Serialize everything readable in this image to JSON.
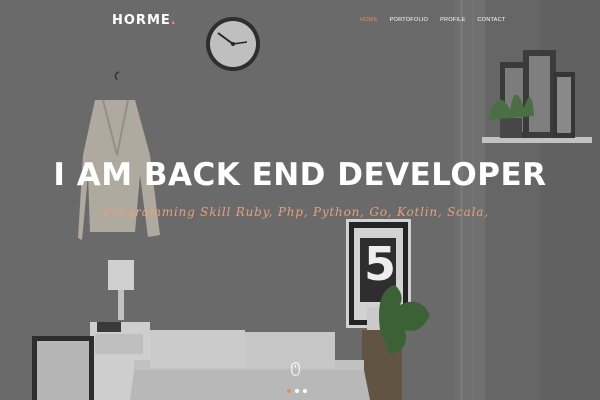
{
  "brand": {
    "name": "HORME",
    "dot": "."
  },
  "nav": {
    "items": [
      {
        "label": "HOME",
        "active": true
      },
      {
        "label": "PORTOFOLIO",
        "active": false
      },
      {
        "label": "PROFILE",
        "active": false
      },
      {
        "label": "CONTACT",
        "active": false
      }
    ]
  },
  "hero": {
    "headline": "I AM BACK END DEVELOPER",
    "subheadline": "Programming Skill Ruby, Php, Python, Go, Kotlin, Scala,",
    "poster_number": "5"
  },
  "slider": {
    "count": 3,
    "active_index": 0
  },
  "colors": {
    "accent": "#e58a5f",
    "text": "#ffffff",
    "subheadline": "#e3a181"
  },
  "icons": [
    "mouse-scroll-icon",
    "wall-clock-icon"
  ]
}
